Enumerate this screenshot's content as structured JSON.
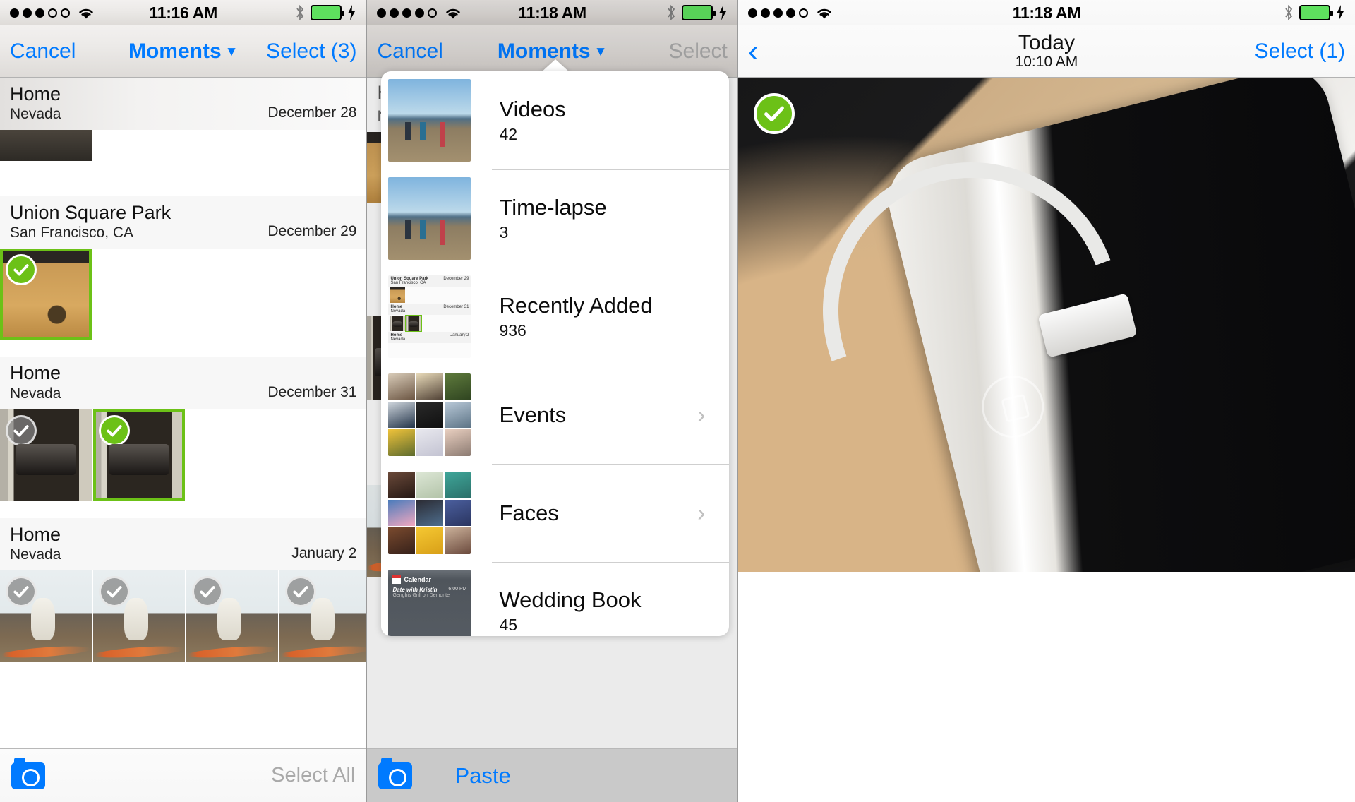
{
  "panels": {
    "left": {
      "status": {
        "signal_filled": 3,
        "signal_total": 5,
        "wifi": "wifi-icon",
        "time": "11:16 AM",
        "bluetooth": "bluetooth-icon",
        "battery": "battery-icon",
        "charging": "bolt-icon"
      },
      "nav": {
        "cancel": "Cancel",
        "title": "Moments",
        "caret": "▼",
        "select": "Select (3)"
      },
      "moments": [
        {
          "title": "Home",
          "subtitle": "Nevada",
          "date": "December 28",
          "photos": [
            {
              "style": "ph-dark",
              "checked": false,
              "partial": true
            }
          ]
        },
        {
          "title": "Union Square Park",
          "subtitle": "San Francisco, CA",
          "date": "December 29",
          "photos": [
            {
              "style": "ph-box",
              "checked": true
            }
          ]
        },
        {
          "title": "Home",
          "subtitle": "Nevada",
          "date": "December 31",
          "photos": [
            {
              "style": "ph-grill",
              "checked": false
            },
            {
              "style": "ph-grill",
              "checked": true
            }
          ]
        },
        {
          "title": "Home",
          "subtitle": "Nevada",
          "date": "January 2",
          "photos": [
            {
              "style": "ph-dog",
              "checked": false
            },
            {
              "style": "ph-dog",
              "checked": false
            },
            {
              "style": "ph-dog",
              "checked": false
            },
            {
              "style": "ph-dog",
              "checked": false
            }
          ]
        }
      ],
      "toolbar": {
        "camera": "camera-icon",
        "select_all": "Select All"
      }
    },
    "mid": {
      "status": {
        "signal_filled": 4,
        "signal_total": 5,
        "time": "11:18 AM"
      },
      "nav": {
        "cancel": "Cancel",
        "title": "Moments",
        "caret": "▼",
        "select": "Select"
      },
      "popover": {
        "items": [
          {
            "label": "Videos",
            "count": "42",
            "thumb": "beach-stack",
            "chevron": false
          },
          {
            "label": "Time-lapse",
            "count": "3",
            "thumb": "beach-stack",
            "chevron": false
          },
          {
            "label": "Recently Added",
            "count": "936",
            "thumb": "moments-list",
            "chevron": false
          },
          {
            "label": "Events",
            "count": "",
            "thumb": "photo-grid-a",
            "chevron": true
          },
          {
            "label": "Faces",
            "count": "",
            "thumb": "photo-grid-b",
            "chevron": true
          },
          {
            "label": "Wedding Book",
            "count": "45",
            "thumb": "calendar-screenshot",
            "chevron": false
          }
        ],
        "mini_list": [
          {
            "title": "Union Square Park",
            "subtitle": "San Francisco, CA",
            "date": "December 29"
          },
          {
            "title": "Home",
            "subtitle": "Nevada",
            "date": "December 31"
          },
          {
            "title": "Home",
            "subtitle": "Nevada",
            "date": "January 2"
          }
        ],
        "calendar_card": {
          "app": "Calendar",
          "event": "Date with Kristin",
          "place": "Genghis Grill on Demonte",
          "time": "6:00 PM"
        }
      },
      "toolbar": {
        "camera": "camera-icon",
        "paste": "Paste"
      }
    },
    "right": {
      "status": {
        "signal_filled": 4,
        "signal_total": 5,
        "time": "11:18 AM"
      },
      "nav": {
        "back": "chevron-left-icon",
        "title": "Today",
        "subtitle": "10:10 AM",
        "select": "Select (1)"
      },
      "photo": {
        "checked": true,
        "description": "ipad-with-cable"
      }
    }
  },
  "colors": {
    "accent": "#007aff",
    "selected_green": "#6cc117",
    "dim_gray": "#a9a9a9"
  }
}
